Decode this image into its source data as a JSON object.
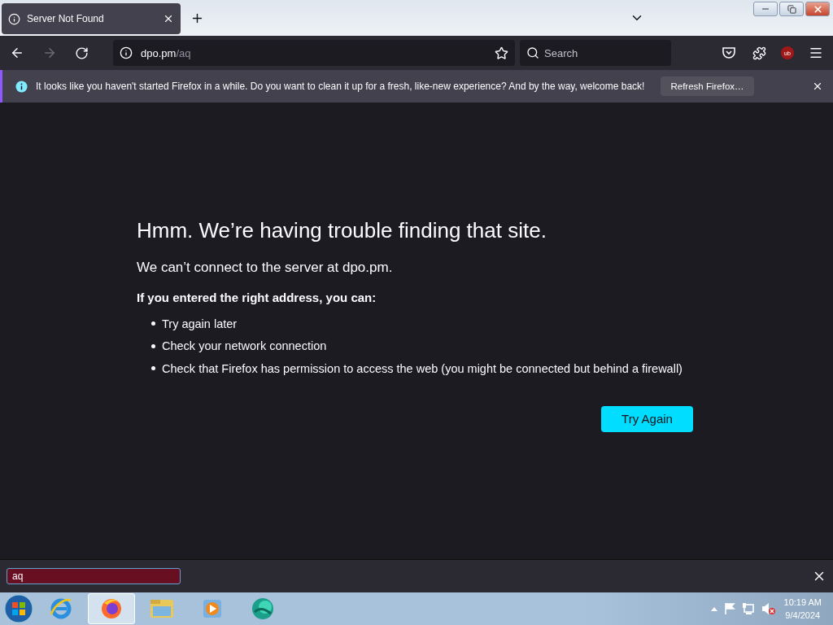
{
  "tab": {
    "title": "Server Not Found",
    "selected": true
  },
  "toolbar": {
    "back_disabled": false,
    "forward_disabled": true,
    "url_host": "dpo.pm",
    "url_path": "/aq",
    "search_placeholder": "Search",
    "extension_badge": "ub"
  },
  "notification": {
    "message": "It looks like you haven't started Firefox in a while. Do you want to clean it up for a fresh, like-new experience? And by the way, welcome back!",
    "button": "Refresh Firefox…"
  },
  "error_page": {
    "title": "Hmm. We’re having trouble finding that site.",
    "subtitle": "We can’t connect to the server at dpo.pm.",
    "advice": "If you entered the right address, you can:",
    "items": [
      "Try again later",
      "Check your network connection",
      "Check that Firefox has permission to access the web (you might be connected but behind a firewall)"
    ],
    "button": "Try Again"
  },
  "find_bar": {
    "value": "aq",
    "not_found": true
  },
  "taskbar": {
    "apps": [
      {
        "kind": "ie",
        "selected": false
      },
      {
        "kind": "firefox",
        "selected": true
      },
      {
        "kind": "explorer",
        "selected": false
      },
      {
        "kind": "media",
        "selected": false
      },
      {
        "kind": "globe",
        "selected": false
      }
    ],
    "time": "10:19 AM",
    "date": "9/4/2024"
  }
}
